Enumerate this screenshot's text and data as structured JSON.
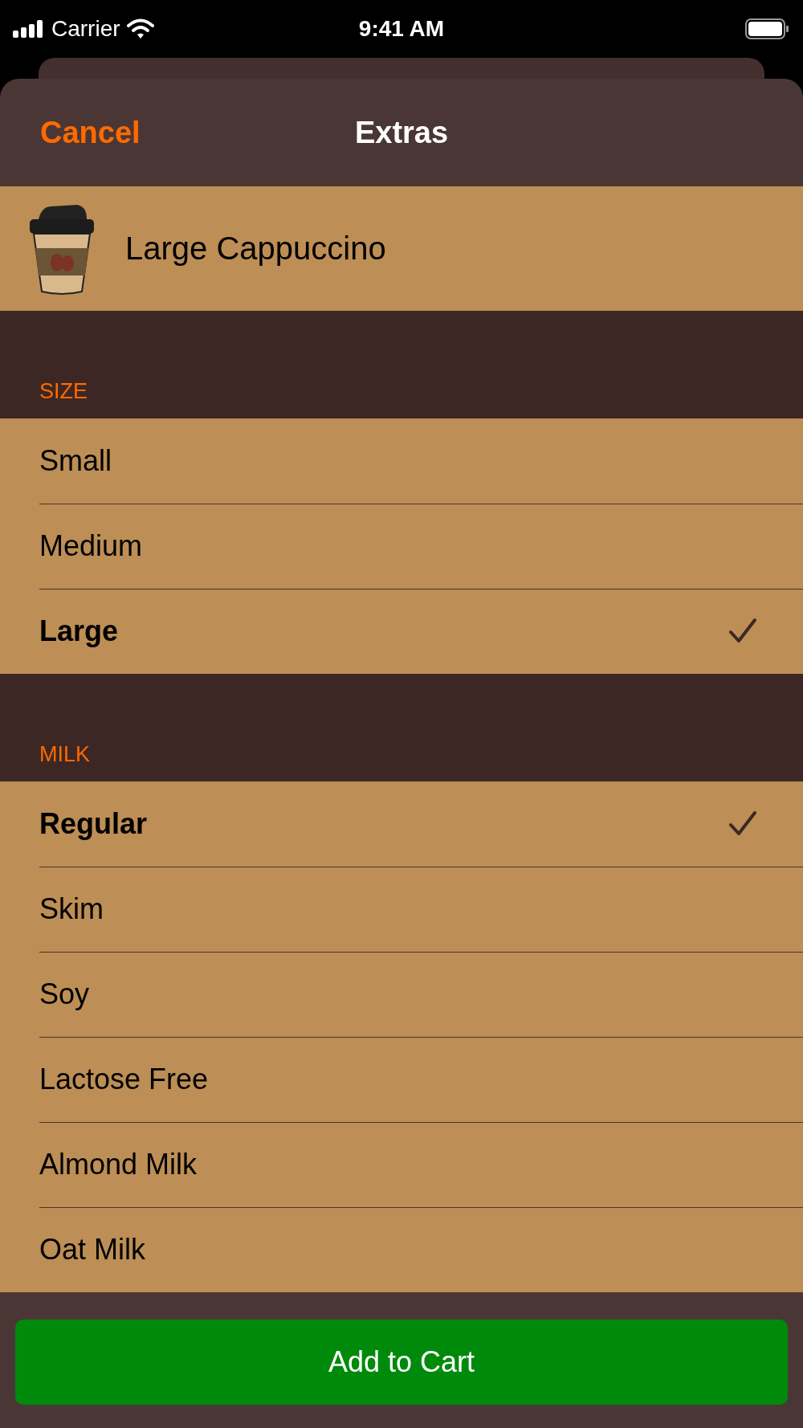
{
  "status_bar": {
    "carrier": "Carrier",
    "time": "9:41 AM"
  },
  "nav": {
    "cancel": "Cancel",
    "title": "Extras"
  },
  "product": {
    "name": "Large Cappuccino"
  },
  "sections": [
    {
      "header": "SIZE",
      "options": [
        {
          "label": "Small",
          "selected": false
        },
        {
          "label": "Medium",
          "selected": false
        },
        {
          "label": "Large",
          "selected": true
        }
      ]
    },
    {
      "header": "MILK",
      "options": [
        {
          "label": "Regular",
          "selected": true
        },
        {
          "label": "Skim",
          "selected": false
        },
        {
          "label": "Soy",
          "selected": false
        },
        {
          "label": "Lactose Free",
          "selected": false
        },
        {
          "label": "Almond Milk",
          "selected": false
        },
        {
          "label": "Oat Milk",
          "selected": false
        }
      ]
    }
  ],
  "button": "Add to Cart"
}
